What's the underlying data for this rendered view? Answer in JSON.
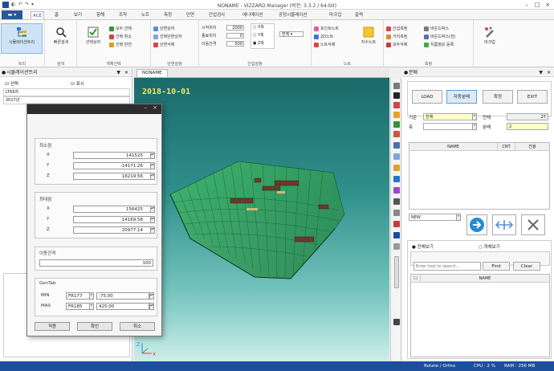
{
  "window": {
    "title": "NONAME - VIZZARD Manager (버전: 3.3.2 / 64-bit)"
  },
  "quick_access": [
    "◐",
    "↶",
    "↷",
    "▾"
  ],
  "ribbon_tabs": [
    {
      "label": "ACE"
    },
    {
      "label": "홈"
    },
    {
      "label": "보기"
    },
    {
      "label": "항해"
    },
    {
      "label": "조작"
    },
    {
      "label": "노트"
    },
    {
      "label": "측정"
    },
    {
      "label": "단면"
    },
    {
      "label": "간섭검사"
    },
    {
      "label": "애니메이션"
    },
    {
      "label": "공정시뮬레이션"
    },
    {
      "label": "마크업"
    },
    {
      "label": "출력"
    }
  ],
  "ribbon": {
    "groups": [
      {
        "label": "트리",
        "big": "시뮬레이션트리"
      },
      {
        "label": "검색",
        "big": "빠른검색"
      },
      {
        "label": "개체선택",
        "big": "선택상자",
        "small": [
          "모두 선택",
          "선택 취소",
          "선택 반전"
        ]
      },
      {
        "label": "단면설정",
        "small": [
          "단면상자",
          "선택단면상자",
          "단면삭제"
        ]
      },
      {
        "label": "간섭설정",
        "fields": [
          {
            "label": "시작위치",
            "value": "2000"
          },
          {
            "label": "종료위치",
            "value": "0"
          },
          {
            "label": "이동간격",
            "value": "500"
          }
        ],
        "options": [
          "X축",
          "Y축",
          "Z축"
        ],
        "combo": "전체"
      },
      {
        "label": "노트",
        "small": [
          "포인트노트",
          "2D노트",
          "노트삭제"
        ],
        "big": "치수노트"
      },
      {
        "label": "측정",
        "small": [
          "간섭측정",
          "거리측정",
          "모두삭제",
          "바운드박스",
          "바운드박스(전)",
          "지름정보 등록"
        ]
      },
      {
        "label": "",
        "big": "마크업"
      }
    ]
  },
  "left_panel": {
    "title": "시뮬레이션트리",
    "check_select": "선택",
    "check_visible": "표시",
    "tree_rows": [
      "LT66차",
      "2017년"
    ]
  },
  "viewport": {
    "tab": "NONAME",
    "date_overlay": "2018-10-01",
    "axis_z": "Z",
    "axis_x": "X"
  },
  "dialog": {
    "start_group": {
      "title": "최소점",
      "x": {
        "label": "X",
        "value": "141525"
      },
      "y": {
        "label": "Y",
        "value": "-14171.26"
      },
      "z": {
        "label": "Z",
        "value": "18219.56"
      }
    },
    "end_group": {
      "title": "최대점",
      "x": {
        "label": "X",
        "value": "156425"
      },
      "y": {
        "label": "Y",
        "value": "14169.58"
      },
      "z": {
        "label": "Z",
        "value": "20977.14"
      }
    },
    "step_group": {
      "title": "이동간격",
      "value": "100"
    },
    "gentab": {
      "title": "GenTab",
      "min": {
        "label": "MIN",
        "frame": "FR177",
        "value": "-75.00"
      },
      "max": {
        "label": "MAX",
        "frame": "FR185",
        "value": "425.00"
      }
    },
    "buttons": {
      "apply": "적용",
      "ok": "확인",
      "cancel": "취소"
    }
  },
  "right_panel": {
    "title": "분배",
    "buttons": [
      "LOAD",
      "자동분배",
      "확정",
      "EXIT"
    ],
    "criteria_label": "기준",
    "criteria_value": "전체",
    "sub_label": "축",
    "total_label": "전체",
    "total_value": "27",
    "split_label": "분배",
    "split_value": "2",
    "grid_headers": [
      "NAME",
      "CNT",
      "진율"
    ],
    "new_combo": "NEW",
    "radio_all": "전체보기",
    "radio_each": "개체보기",
    "search_placeholder": "Enter text to search...",
    "find_label": "Find",
    "clear_label": "Clear",
    "list_header": "NAME"
  },
  "status": {
    "mode": "Rotate / Ortho",
    "cpu": "CPU : 2 %",
    "ram": "RAM : 256 MB"
  },
  "colors": {
    "accent": "#1b4f9c",
    "date": "#ffe14a",
    "go_button": "#1e8fd6"
  }
}
